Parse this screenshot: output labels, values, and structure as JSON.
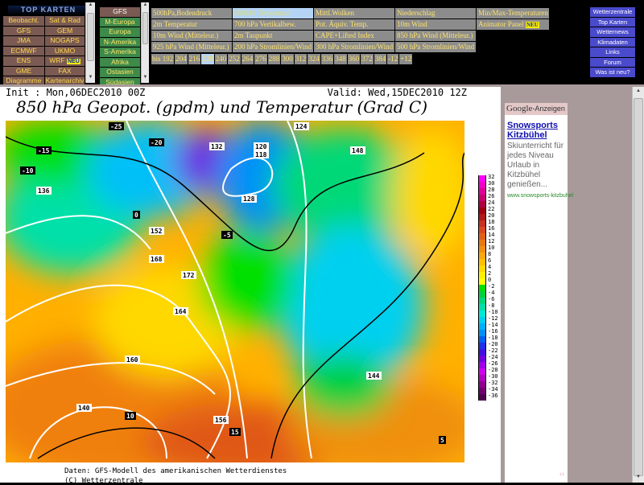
{
  "logo": "TOP KARTEN",
  "models": [
    "Beobacht.",
    "Sat & Rad",
    "GFS",
    "GEM",
    "JMA",
    "NOGAPS",
    "ECMWF",
    "UKMO",
    "ENS",
    "WRF",
    "GME",
    "FAX",
    "Diagramme",
    "Kartenarchiv"
  ],
  "new_badge": "NEU",
  "regions": {
    "header": "GFS",
    "items": [
      "M-Europa",
      "Europa",
      "N-Amerika",
      "S-Amerika",
      "Afrika",
      "Ostasien",
      "Südasien"
    ]
  },
  "params": [
    "500hPa,Bodendruck",
    "850hPa Temperatur",
    "Mittl.Wolken",
    "Niederschlag",
    "Min/Max-Temperaturen",
    "2m Temperatur",
    "700 hPa Vertikalbew.",
    "Pot. Äquiv. Temp.",
    "10m Wind",
    "Animator Panel",
    "10m Wind (Mitteleur.)",
    "2m Taupunkt",
    "CAPE+Lifted Index",
    "850 hPa Wind (Mitteleur.)",
    "",
    "925 hPa Wind (Mitteleur.)",
    "200 hPa Stromlinien/Wind",
    "300 hPa Stromlinien/Wind",
    "500 hPa Stromlinien/Wind",
    ""
  ],
  "hours": [
    "bis 192",
    "204",
    "216",
    "228",
    "240",
    "252",
    "264",
    "276",
    "288",
    "300",
    "312",
    "324",
    "336",
    "348",
    "360",
    "372",
    "384",
    "-12",
    "+12"
  ],
  "nav": [
    "Wetterzentrale",
    "Top Karten",
    "Wetternews",
    "Klimadaten",
    "Links",
    "Forum",
    "Was ist neu?"
  ],
  "map": {
    "init": "Init : Mon,06DEC2010 00Z",
    "valid": "Valid: Wed,15DEC2010 12Z",
    "title": "850 hPa Geopot. (gpdm) und Temperatur (Grad C)",
    "footer1": "Daten: GFS-Modell des amerikanischen Wetterdienstes",
    "footer2": "(C) Wetterzentrale",
    "labels": [
      "-25",
      "-20",
      "-15",
      "-10",
      "-5",
      "0",
      "5",
      "10",
      "15",
      "118",
      "120",
      "124",
      "128",
      "132",
      "136",
      "140",
      "144",
      "148",
      "152",
      "156",
      "160",
      "164",
      "168",
      "172"
    ]
  },
  "colorbar": {
    "ticks": [
      "32",
      "30",
      "28",
      "26",
      "24",
      "22",
      "20",
      "18",
      "16",
      "14",
      "12",
      "10",
      "8",
      "6",
      "4",
      "2",
      "0",
      "-2",
      "-4",
      "-6",
      "-8",
      "-10",
      "-12",
      "-14",
      "-16",
      "-18",
      "-20",
      "-22",
      "-24",
      "-26",
      "-28",
      "-30",
      "-32",
      "-34",
      "-36"
    ],
    "colors": [
      "#ff00ff",
      "#f000c8",
      "#e0009a",
      "#c80070",
      "#b00040",
      "#a00010",
      "#b01818",
      "#c83020",
      "#d84820",
      "#e06018",
      "#e87810",
      "#f09010",
      "#f8a810",
      "#ffc000",
      "#ffd800",
      "#ffee00",
      "#ffff00",
      "#00e000",
      "#00d040",
      "#00d878",
      "#00e0a8",
      "#00e8d8",
      "#00d0f0",
      "#00b0f8",
      "#0090f8",
      "#0060f0",
      "#2030e8",
      "#4010e0",
      "#7000e0",
      "#a000e8",
      "#d000f0",
      "#b000c0",
      "#900090",
      "#700070",
      "#500050"
    ]
  },
  "ad": {
    "header_brand": "Google",
    "header_suffix": "-Anzeigen",
    "title": "Snowsports Kitzbühel",
    "body": "Skiunterricht für jedes Niveau Urlaub in Kitzbühel genießen...",
    "url": "www.snowsports-kitzbuhel"
  }
}
